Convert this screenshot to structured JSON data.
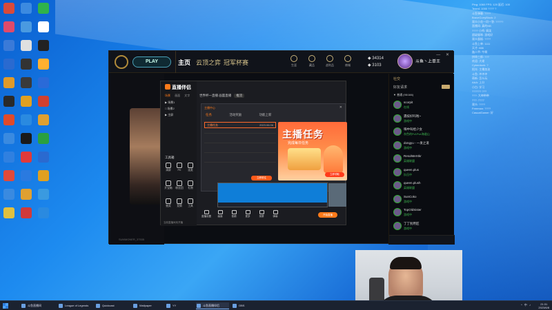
{
  "desktop": {
    "icon_colors": [
      "#d84a3a",
      "#3c8ae0",
      "#2fb34a",
      "#e04a6a",
      "#4a9ae0",
      "#ffffff",
      "#3a7ad8",
      "#e0e0e0",
      "#222222",
      "#2a6ad0",
      "#333333",
      "#ffb030",
      "#e09a2a",
      "#3a3a3a",
      "#2a6ad8",
      "#2a2a2a",
      "#e0a020",
      "#d04030",
      "#e04a2a",
      "#2a8ae0",
      "#e0a030",
      "#3a8ae0",
      "#1a1a1a",
      "#2aa040",
      "#3080e0",
      "#e03a3a",
      "#2a6ad0",
      "#e04a3a",
      "#2a7ae0",
      "#e0a020",
      "#3a8ae0",
      "#e0a030",
      "#3a9ae0",
      "#e0c040",
      "#d03a3a",
      "#2a8ae0"
    ]
  },
  "lol": {
    "play_label": "PLAY",
    "nav": [
      "主页",
      "云顶之弈",
      "冠军杯赛"
    ],
    "top_icons": [
      "生涯",
      "藏品",
      "战利品",
      "商城"
    ],
    "currency": [
      "34314",
      "3103"
    ],
    "username": "斗鱼丶上单王",
    "win_controls": "— ✕",
    "footer": "SUMMONER_37535",
    "friends": {
      "header": "社交",
      "title": "好友请求",
      "group": "▼ 普通 (95/166)",
      "items": [
        {
          "name": "scorpit",
          "status": "在线"
        },
        {
          "name": "遇技好吗啦~",
          "status": "游戏中"
        },
        {
          "name": "嗨中叫给少女",
          "status": "灰色的Pv1Pve海道山"
        },
        {
          "name": "dongyu - 一发之道",
          "status": "游戏中"
        },
        {
          "name": "ResolMeXIkr",
          "status": "英雄联盟"
        },
        {
          "name": "queen.plus",
          "status": "队伍中"
        },
        {
          "name": "queen.plush",
          "status": "英雄联盟"
        },
        {
          "name": "SunCoko",
          "status": "游戏中"
        },
        {
          "name": "TopOldSister",
          "status": "游戏中"
        },
        {
          "name": "丁丁别用匠",
          "status": "游戏中"
        }
      ]
    }
  },
  "stream_app": {
    "logo": "直播伴侣",
    "tabs": [
      "场景",
      "画面",
      "文字"
    ],
    "scenes": [
      "▶ 场景1",
      "□ 场景2",
      "▶ 主屏"
    ],
    "tools_title": "工具箱",
    "tools": [
      "清屏",
      "PK",
      "连麦",
      "开宝箱",
      "粉丝团",
      "礼物",
      "抽奖",
      "竞猜",
      "工具"
    ],
    "main_top": "世界杯一直播  画面直播",
    "main_top_pill": "推流",
    "dialog": {
      "title": "主播中心",
      "close": "✕",
      "tabs": [
        "任务",
        "活动奖励",
        "功能上新"
      ],
      "row_label": "主播任务",
      "row_time": "2023.06.06",
      "promo_title": "主播任务",
      "promo_sub": "完成每日任务",
      "promo_btn": "立即领取",
      "left_btn": "立即前往"
    },
    "bottom": [
      "直播设置",
      "画面",
      "音频",
      "更多",
      "录屏",
      "弹幕"
    ],
    "live_label": "开始直播",
    "footer": "当前直播间未开播"
  },
  "overlay_text": [
    "Ping: 1060  FPS: 120  延迟: 100",
    "Team1 1000  ????   ?",
    "斗鱼弹幕: ????",
    "BraveCurryBlock: 2",
    "观众小花一问一答: ?????",
    "直播间: 真的NB",
    "???? 小鸡: 搞笑",
    "超级猫咪: 游戏好",
    "观众蛋糕: ????",
    "斗鱼上单: 1111",
    "天才: 666",
    "路人甲: 牛啊",
    "拼命三郎: ???",
    "欢迎: 大佬",
    "Cyberduck: ?",
    "阳光: 主播加油",
    "斗鱼: 冲冲冲",
    "萌新: 怎么玩",
    "AAA: 上分",
    "小白: 学习",
    "?????? ???",
    "???: 大神带带",
    "777: 7777",
    "观众: ????",
    "Freeman: ????",
    "CasualGamer: 好"
  ],
  "taskbar": {
    "items": [
      "斗鱼直播间",
      "League of Legends",
      "Quickcast",
      "Wallpaper",
      "YY",
      "斗鱼直播伴侣",
      "OBS"
    ],
    "active_index": 5,
    "tray_icons": "^ 中 ♪",
    "time": "21:31",
    "date": "2023/6/8"
  }
}
